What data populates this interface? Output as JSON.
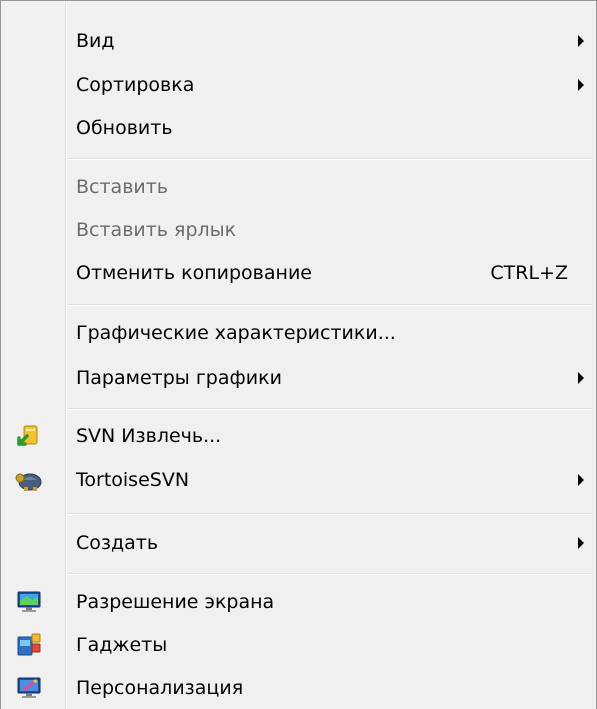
{
  "menu": {
    "items": {
      "view": {
        "label": "Вид",
        "icon": null,
        "submenu": true
      },
      "sort": {
        "label": "Сортировка",
        "icon": null,
        "submenu": true
      },
      "refresh": {
        "label": "Обновить",
        "icon": null
      },
      "paste": {
        "label": "Вставить",
        "disabled": true
      },
      "paste_shortcut": {
        "label": "Вставить ярлык",
        "disabled": true
      },
      "undo_copy": {
        "label": "Отменить копирование",
        "shortcut": "CTRL+Z"
      },
      "graphics_properties": {
        "label": "Графические характеристики..."
      },
      "graphics_options": {
        "label": "Параметры графики",
        "submenu": true
      },
      "svn_checkout": {
        "label": "SVN Извлечь...",
        "icon": "svn-checkout-icon"
      },
      "tortoisesvn": {
        "label": "TortoiseSVN",
        "icon": "tortoisesvn-icon",
        "submenu": true
      },
      "create": {
        "label": "Создать",
        "submenu": true
      },
      "screen_resolution": {
        "label": "Разрешение экрана",
        "icon": "screen-resolution-icon"
      },
      "gadgets": {
        "label": "Гаджеты",
        "icon": "gadgets-icon"
      },
      "personalization": {
        "label": "Персонализация",
        "icon": "personalization-icon"
      }
    },
    "colors": {
      "background": "#f0f0f0",
      "disabled_text": "#6d6d6d",
      "border": "#979797"
    }
  }
}
